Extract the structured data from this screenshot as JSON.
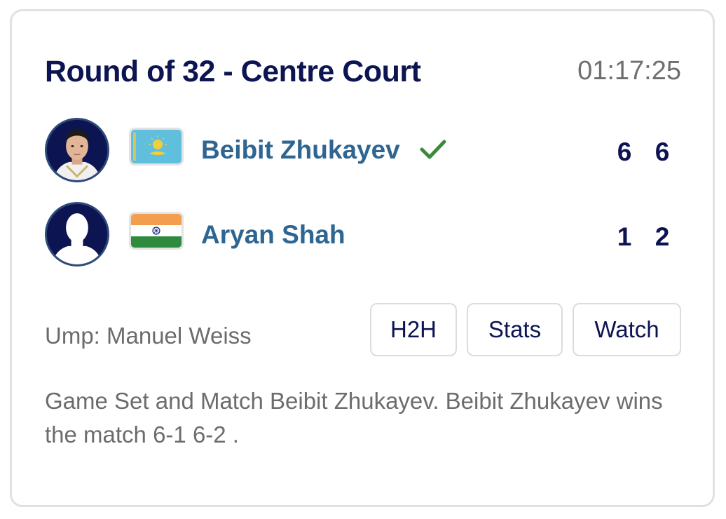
{
  "match": {
    "title": "Round of 32 - Centre Court",
    "duration": "01:17:25"
  },
  "players": [
    {
      "name": "Beibit Zhukayev",
      "country_flag": "kazakhstan-flag",
      "winner": true,
      "sets": [
        "6",
        "6"
      ],
      "avatar": "player-photo"
    },
    {
      "name": "Aryan Shah",
      "country_flag": "india-flag",
      "winner": false,
      "sets": [
        "1",
        "2"
      ],
      "avatar": "placeholder-silhouette"
    }
  ],
  "umpire": "Ump: Manuel Weiss",
  "buttons": {
    "h2h": "H2H",
    "stats": "Stats",
    "watch": "Watch"
  },
  "summary": "Game Set and Match Beibit Zhukayev. Beibit Zhukayev wins the match 6-1 6-2 .",
  "colors": {
    "title": "#0d1452",
    "player_name": "#2f6591",
    "winner_check": "#3b8a3b",
    "muted_text": "#6c6c6c"
  }
}
